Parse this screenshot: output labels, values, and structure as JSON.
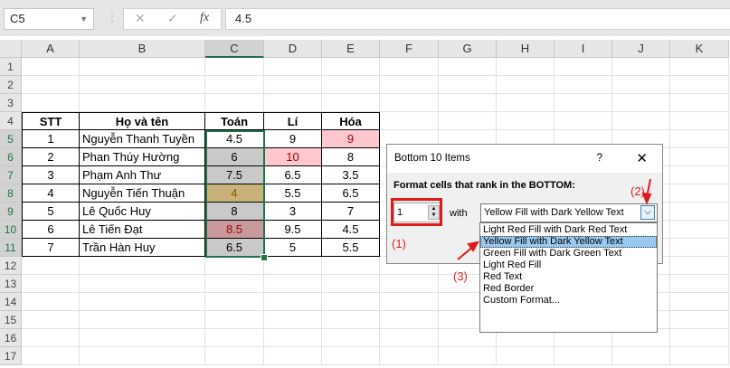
{
  "formula_bar": {
    "name_box": "C5",
    "cancel": "✕",
    "enter": "✓",
    "fx": "fx",
    "value": "4.5"
  },
  "columns": [
    "A",
    "B",
    "C",
    "D",
    "E",
    "F",
    "G",
    "H",
    "I",
    "J",
    "K"
  ],
  "rows": [
    "1",
    "2",
    "3",
    "4",
    "5",
    "6",
    "7",
    "8",
    "9",
    "10",
    "11",
    "12",
    "13",
    "14",
    "15",
    "16",
    "17"
  ],
  "table": {
    "headers": [
      "STT",
      "Họ và tên",
      "Toán",
      "Lí",
      "Hóa"
    ],
    "records": [
      [
        "1",
        "Nguyễn Thanh Tuyền",
        "4.5",
        "9",
        "9"
      ],
      [
        "2",
        "Phan Thúy Hường",
        "6",
        "10",
        "8"
      ],
      [
        "3",
        "Phạm Anh Thư",
        "7.5",
        "6.5",
        "3.5"
      ],
      [
        "4",
        "Nguyễn Tiến Thuận",
        "4",
        "5.5",
        "6.5"
      ],
      [
        "5",
        "Lê Quốc Huy",
        "8",
        "3",
        "7"
      ],
      [
        "6",
        "Lê Tiến Đạt",
        "8.5",
        "9.5",
        "4.5"
      ],
      [
        "7",
        "Trần Hàn Huy",
        "6.5",
        "5",
        "5.5"
      ]
    ]
  },
  "colors": {
    "gray_fill": "#c9c9c9",
    "yellow_fill": "#c9b27a",
    "yellow_text": "#8a5a00",
    "red_fill": "#c99a9c",
    "red_text": "#9c0006",
    "pink_fill": "#ffc7ce",
    "accent": "#217346"
  },
  "dialog": {
    "title": "Bottom 10 Items",
    "help": "?",
    "close": "✕",
    "label": "Format cells that rank in the BOTTOM:",
    "count": "1",
    "with": "with",
    "selected_format": "Yellow Fill with Dark Yellow Text",
    "options": [
      "Light Red Fill with Dark Red Text",
      "Yellow Fill with Dark Yellow Text",
      "Green Fill with Dark Green Text",
      "Light Red Fill",
      "Red Text",
      "Red Border",
      "Custom Format..."
    ]
  },
  "annotations": {
    "a1": "(1)",
    "a2": "(2)",
    "a3": "(3)"
  }
}
